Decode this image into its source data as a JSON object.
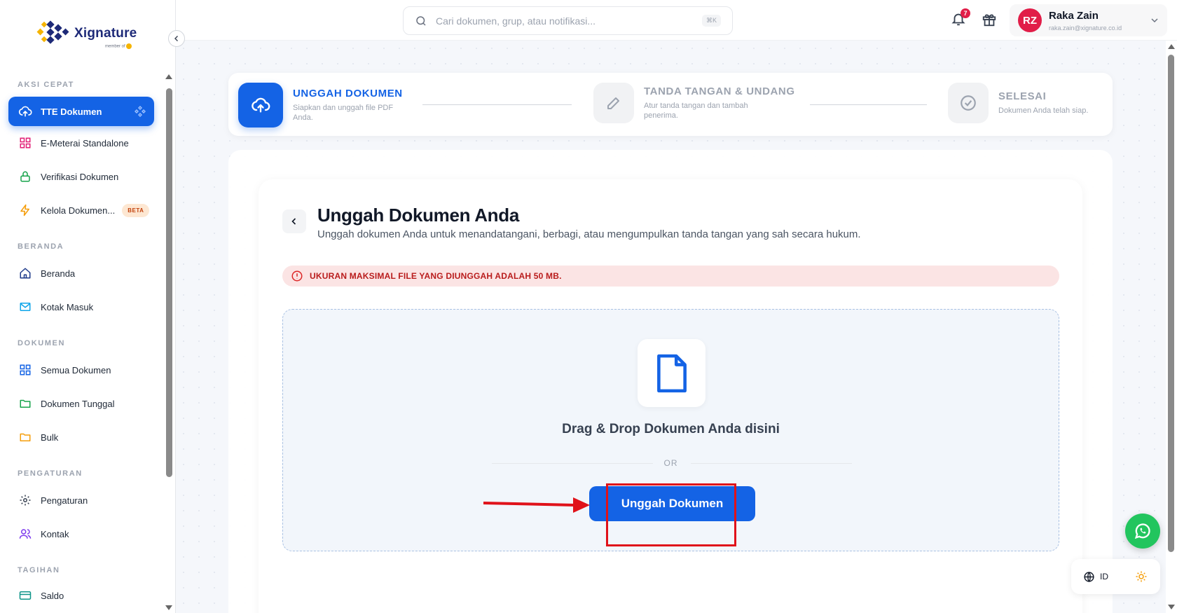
{
  "brand": {
    "name": "Xignature",
    "sub": "member of"
  },
  "search": {
    "placeholder": "Cari dokumen, grup, atau notifikasi...",
    "shortcut": "⌘K"
  },
  "notifications": {
    "count": "7"
  },
  "user": {
    "initials": "RZ",
    "name": "Raka Zain",
    "email": "raka.zain@xignature.co.id"
  },
  "sidebar": {
    "sections": [
      {
        "title": "AKSI CEPAT",
        "items": [
          {
            "label": "TTE Dokumen",
            "icon": "upload-cloud-icon",
            "active": true
          },
          {
            "label": "E-Meterai Standalone",
            "icon": "grid-icon"
          },
          {
            "label": "Verifikasi Dokumen",
            "icon": "lock-icon"
          },
          {
            "label": "Kelola Dokumen...",
            "icon": "lightning-icon",
            "badge": "BETA"
          }
        ]
      },
      {
        "title": "BERANDA",
        "items": [
          {
            "label": "Beranda",
            "icon": "home-icon"
          },
          {
            "label": "Kotak Masuk",
            "icon": "mail-icon"
          }
        ]
      },
      {
        "title": "DOKUMEN",
        "items": [
          {
            "label": "Semua Dokumen",
            "icon": "grid-icon"
          },
          {
            "label": "Dokumen Tunggal",
            "icon": "folder-icon"
          },
          {
            "label": "Bulk",
            "icon": "folder-icon"
          }
        ]
      },
      {
        "title": "PENGATURAN",
        "items": [
          {
            "label": "Pengaturan",
            "icon": "gear-icon"
          },
          {
            "label": "Kontak",
            "icon": "users-icon"
          }
        ]
      },
      {
        "title": "TAGIHAN",
        "items": [
          {
            "label": "Saldo",
            "icon": "card-icon"
          }
        ]
      }
    ]
  },
  "stepper": {
    "steps": [
      {
        "title": "UNGGAH DOKUMEN",
        "desc": "Siapkan dan unggah file PDF Anda.",
        "state": "active"
      },
      {
        "title": "TANDA TANGAN & UNDANG",
        "desc": "Atur tanda tangan dan tambah penerima.",
        "state": "pending"
      },
      {
        "title": "SELESAI",
        "desc": "Dokumen Anda telah siap.",
        "state": "pending"
      }
    ]
  },
  "upload": {
    "title": "Unggah Dokumen Anda",
    "subtitle": "Unggah dokumen Anda untuk menandatangani, berbagi, atau mengumpulkan tanda tangan yang sah secara hukum.",
    "alert": "UKURAN MAKSIMAL FILE YANG DIUNGGAH ADALAH 50 MB.",
    "drop_title": "Drag & Drop Dokumen Anda disini",
    "or": "OR",
    "button": "Unggah Dokumen"
  },
  "language": {
    "code": "ID"
  },
  "colors": {
    "primary": "#1463e5",
    "danger": "#b91c1c",
    "alert_bg": "#fbe4e4",
    "whatsapp": "#22c55e",
    "annotation": "#e0121a"
  }
}
